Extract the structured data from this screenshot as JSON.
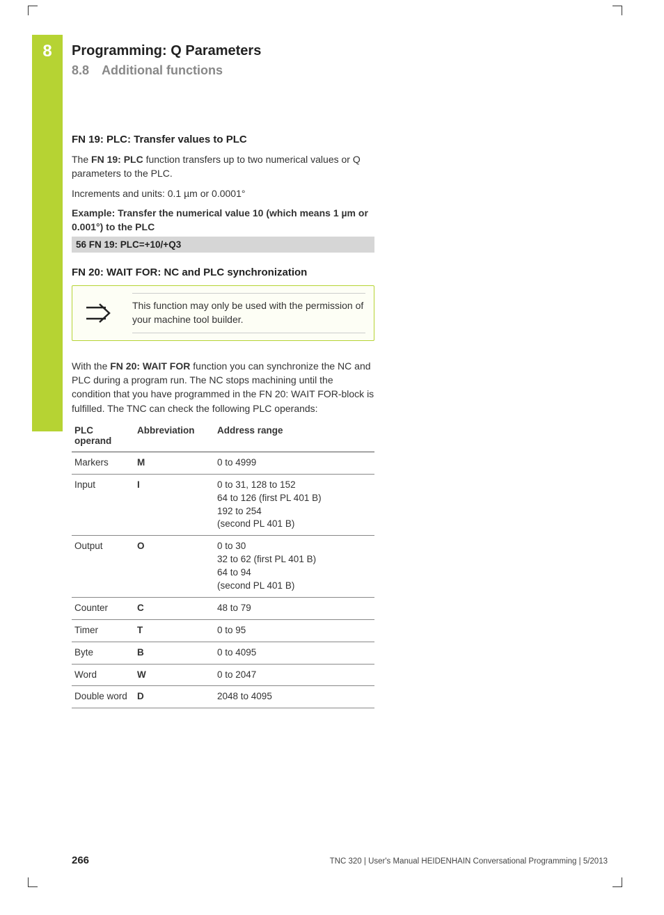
{
  "chapter": "8",
  "title": "Programming: Q Parameters",
  "section_num": "8.8",
  "section_title": "Additional functions",
  "fn19": {
    "heading": "FN 19: PLC: Transfer values to PLC",
    "p1a": "The ",
    "p1b": "FN 19: PLC",
    "p1c": " function transfers up to two numerical values or Q parameters to the PLC.",
    "p2": "Increments and units: 0.1 µm or 0.0001°",
    "example_label": "Example: Transfer the numerical value 10 (which means 1 µm or 0.001°) to the PLC",
    "code": "56 FN 19: PLC=+10/+Q3"
  },
  "fn20": {
    "heading": "FN 20: WAIT FOR: NC and PLC synchronization",
    "note": "This function may only be used with the permission of your machine tool builder.",
    "p1a": "With the ",
    "p1b": "FN 20: WAIT FOR",
    "p1c": " function you can synchronize the NC and PLC during a program run. The NC stops machining until the condition that you have programmed in the FN 20: WAIT FOR-block is fulfilled. The TNC can check the following PLC operands:"
  },
  "table": {
    "h1": "PLC operand",
    "h2": "Abbreviation",
    "h3": "Address range",
    "rows": [
      {
        "operand": "Markers",
        "abbr": "M",
        "range": "0 to 4999"
      },
      {
        "operand": "Input",
        "abbr": "I",
        "range": "0 to 31, 128 to 152\n64 to 126 (first PL 401 B)\n192 to 254\n(second PL 401 B)"
      },
      {
        "operand": "Output",
        "abbr": "O",
        "range": "0 to 30\n32 to 62 (first PL 401 B)\n64 to 94\n(second PL 401 B)"
      },
      {
        "operand": "Counter",
        "abbr": "C",
        "range": "48 to 79"
      },
      {
        "operand": "Timer",
        "abbr": "T",
        "range": "0 to 95"
      },
      {
        "operand": "Byte",
        "abbr": "B",
        "range": "0 to 4095"
      },
      {
        "operand": "Word",
        "abbr": "W",
        "range": "0 to 2047"
      },
      {
        "operand": "Double word",
        "abbr": "D",
        "range": "2048 to 4095"
      }
    ]
  },
  "footer": {
    "page": "266",
    "text": "TNC 320 | User's Manual HEIDENHAIN Conversational Programming | 5/2013"
  }
}
